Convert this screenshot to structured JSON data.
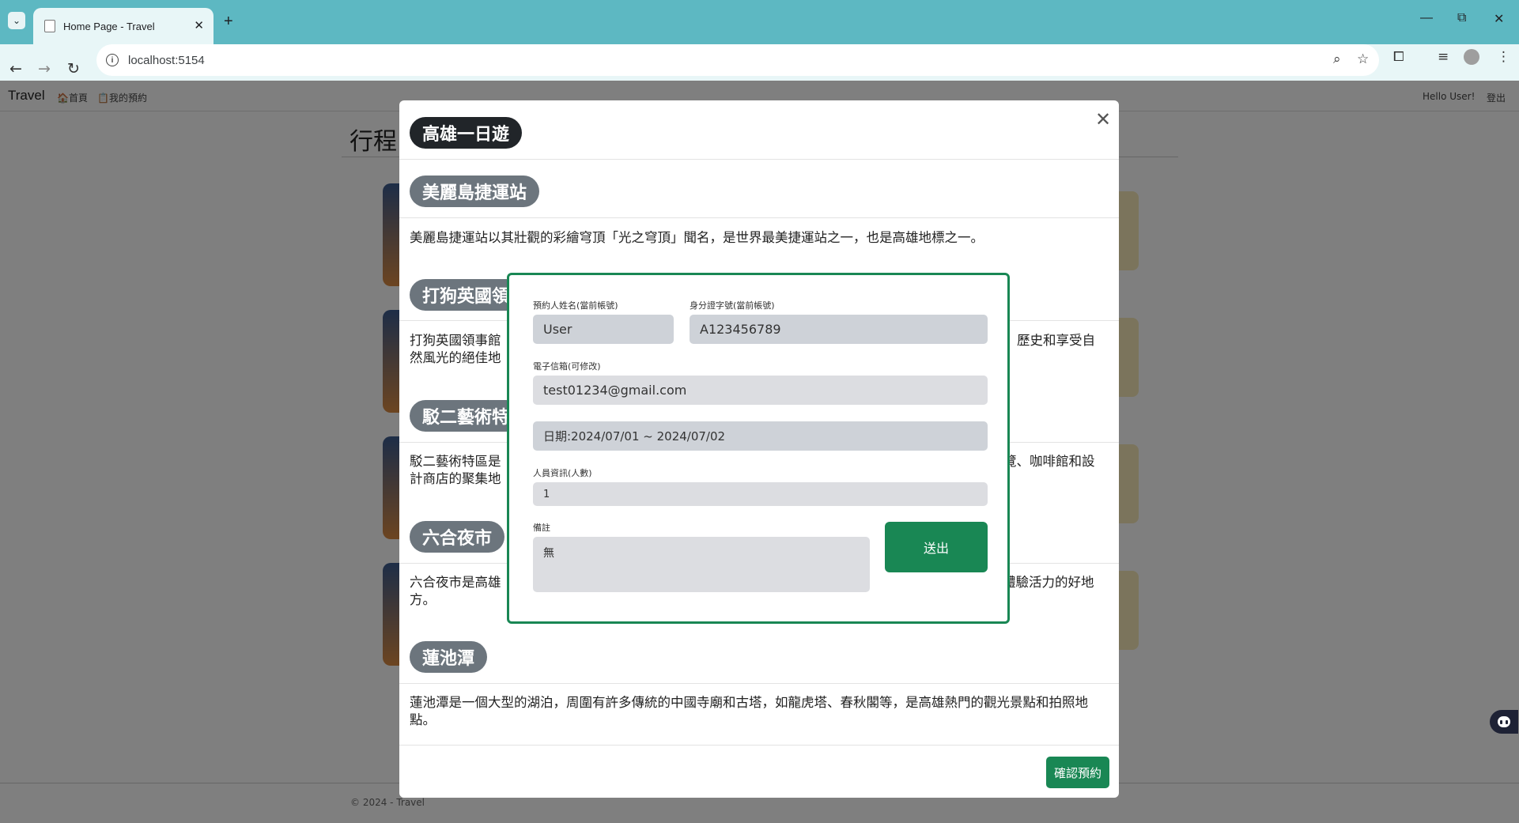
{
  "browser": {
    "tab_title": "Home Page - Travel",
    "url": "localhost:5154"
  },
  "site": {
    "brand": "Travel",
    "nav": [
      "🏠首頁",
      "📋我的預約"
    ],
    "greeting": "Hello User!",
    "logout": "登出",
    "heading": "行程",
    "footer": "© 2024 - Travel"
  },
  "modal": {
    "title": "高雄一日遊",
    "spots": [
      {
        "name": "美麗島捷運站",
        "desc": "美麗島捷運站以其壯觀的彩繪穹頂「光之穹頂」聞名，是世界最美捷運站之一，也是高雄地標之一。"
      },
      {
        "name": "打狗英國領",
        "desc": "打狗英國領事館",
        "desc_right": "歷史和享受自",
        "desc_line2": "然風光的絕佳地"
      },
      {
        "name": "駁二藝術特",
        "desc": "駁二藝術特區是",
        "desc_right": "覽、咖啡館和設",
        "desc_line2": "計商店的聚集地"
      },
      {
        "name": "六合夜市",
        "desc": "六合夜市是高雄",
        "desc_right": "體驗活力的好地",
        "desc_line2": "方。"
      },
      {
        "name": "蓮池潭",
        "desc": "蓮池潭是一個大型的湖泊，周圍有許多傳統的中國寺廟和古塔，如龍虎塔、春秋閣等，是高雄熱門的觀光景點和拍照地點。"
      }
    ],
    "confirm_label": "確認預約"
  },
  "booking": {
    "name_label": "預約人姓名(當前帳號)",
    "name_value": "User",
    "id_label": "身分證字號(當前帳號)",
    "id_value": "A123456789",
    "email_label": "電子信箱(可修改)",
    "email_value": "test01234@gmail.com",
    "date_value": "日期:2024/07/01 ~ 2024/07/02",
    "people_label": "人員資訊(人數)",
    "people_value": "1",
    "note_label": "備註",
    "note_value": "無",
    "submit_label": "送出"
  },
  "colors": {
    "chrome": "#5db8c2",
    "success": "#198754",
    "badge_dark": "#212529",
    "badge_gray": "#6c757d"
  }
}
